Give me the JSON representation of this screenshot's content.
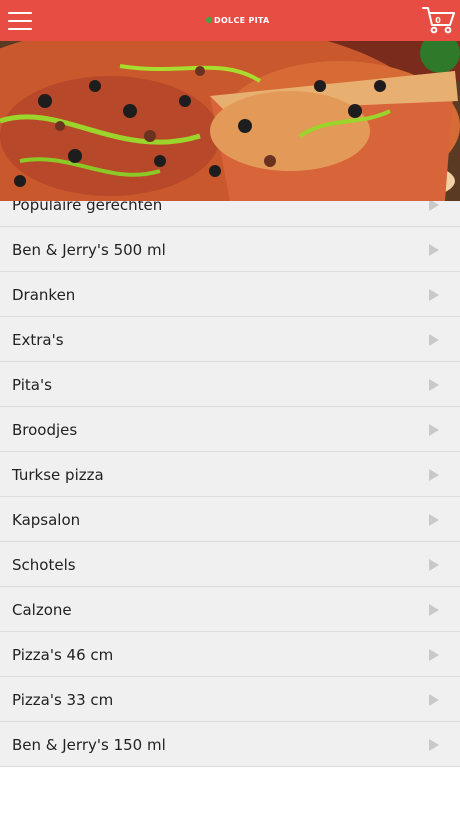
{
  "header": {
    "logo_text": "DOLCE PITA",
    "cart_count": "0",
    "colors": {
      "bar": "#e84d43",
      "icon": "#ffffff"
    },
    "icons": {
      "menu": "hamburger-menu-icon",
      "cart": "shopping-cart-icon"
    }
  },
  "hero": {
    "image": "pizza-photo"
  },
  "categories": [
    {
      "label": "Populaire gerechten"
    },
    {
      "label": "Ben & Jerry's 500 ml"
    },
    {
      "label": "Dranken"
    },
    {
      "label": "Extra's"
    },
    {
      "label": "Pita's"
    },
    {
      "label": "Broodjes"
    },
    {
      "label": "Turkse pizza"
    },
    {
      "label": "Kapsalon"
    },
    {
      "label": "Schotels"
    },
    {
      "label": "Calzone"
    },
    {
      "label": "Pizza's 46 cm"
    },
    {
      "label": "Pizza's 33 cm"
    },
    {
      "label": "Ben & Jerry's 150 ml"
    }
  ],
  "row_icon": "chevron-right-icon"
}
